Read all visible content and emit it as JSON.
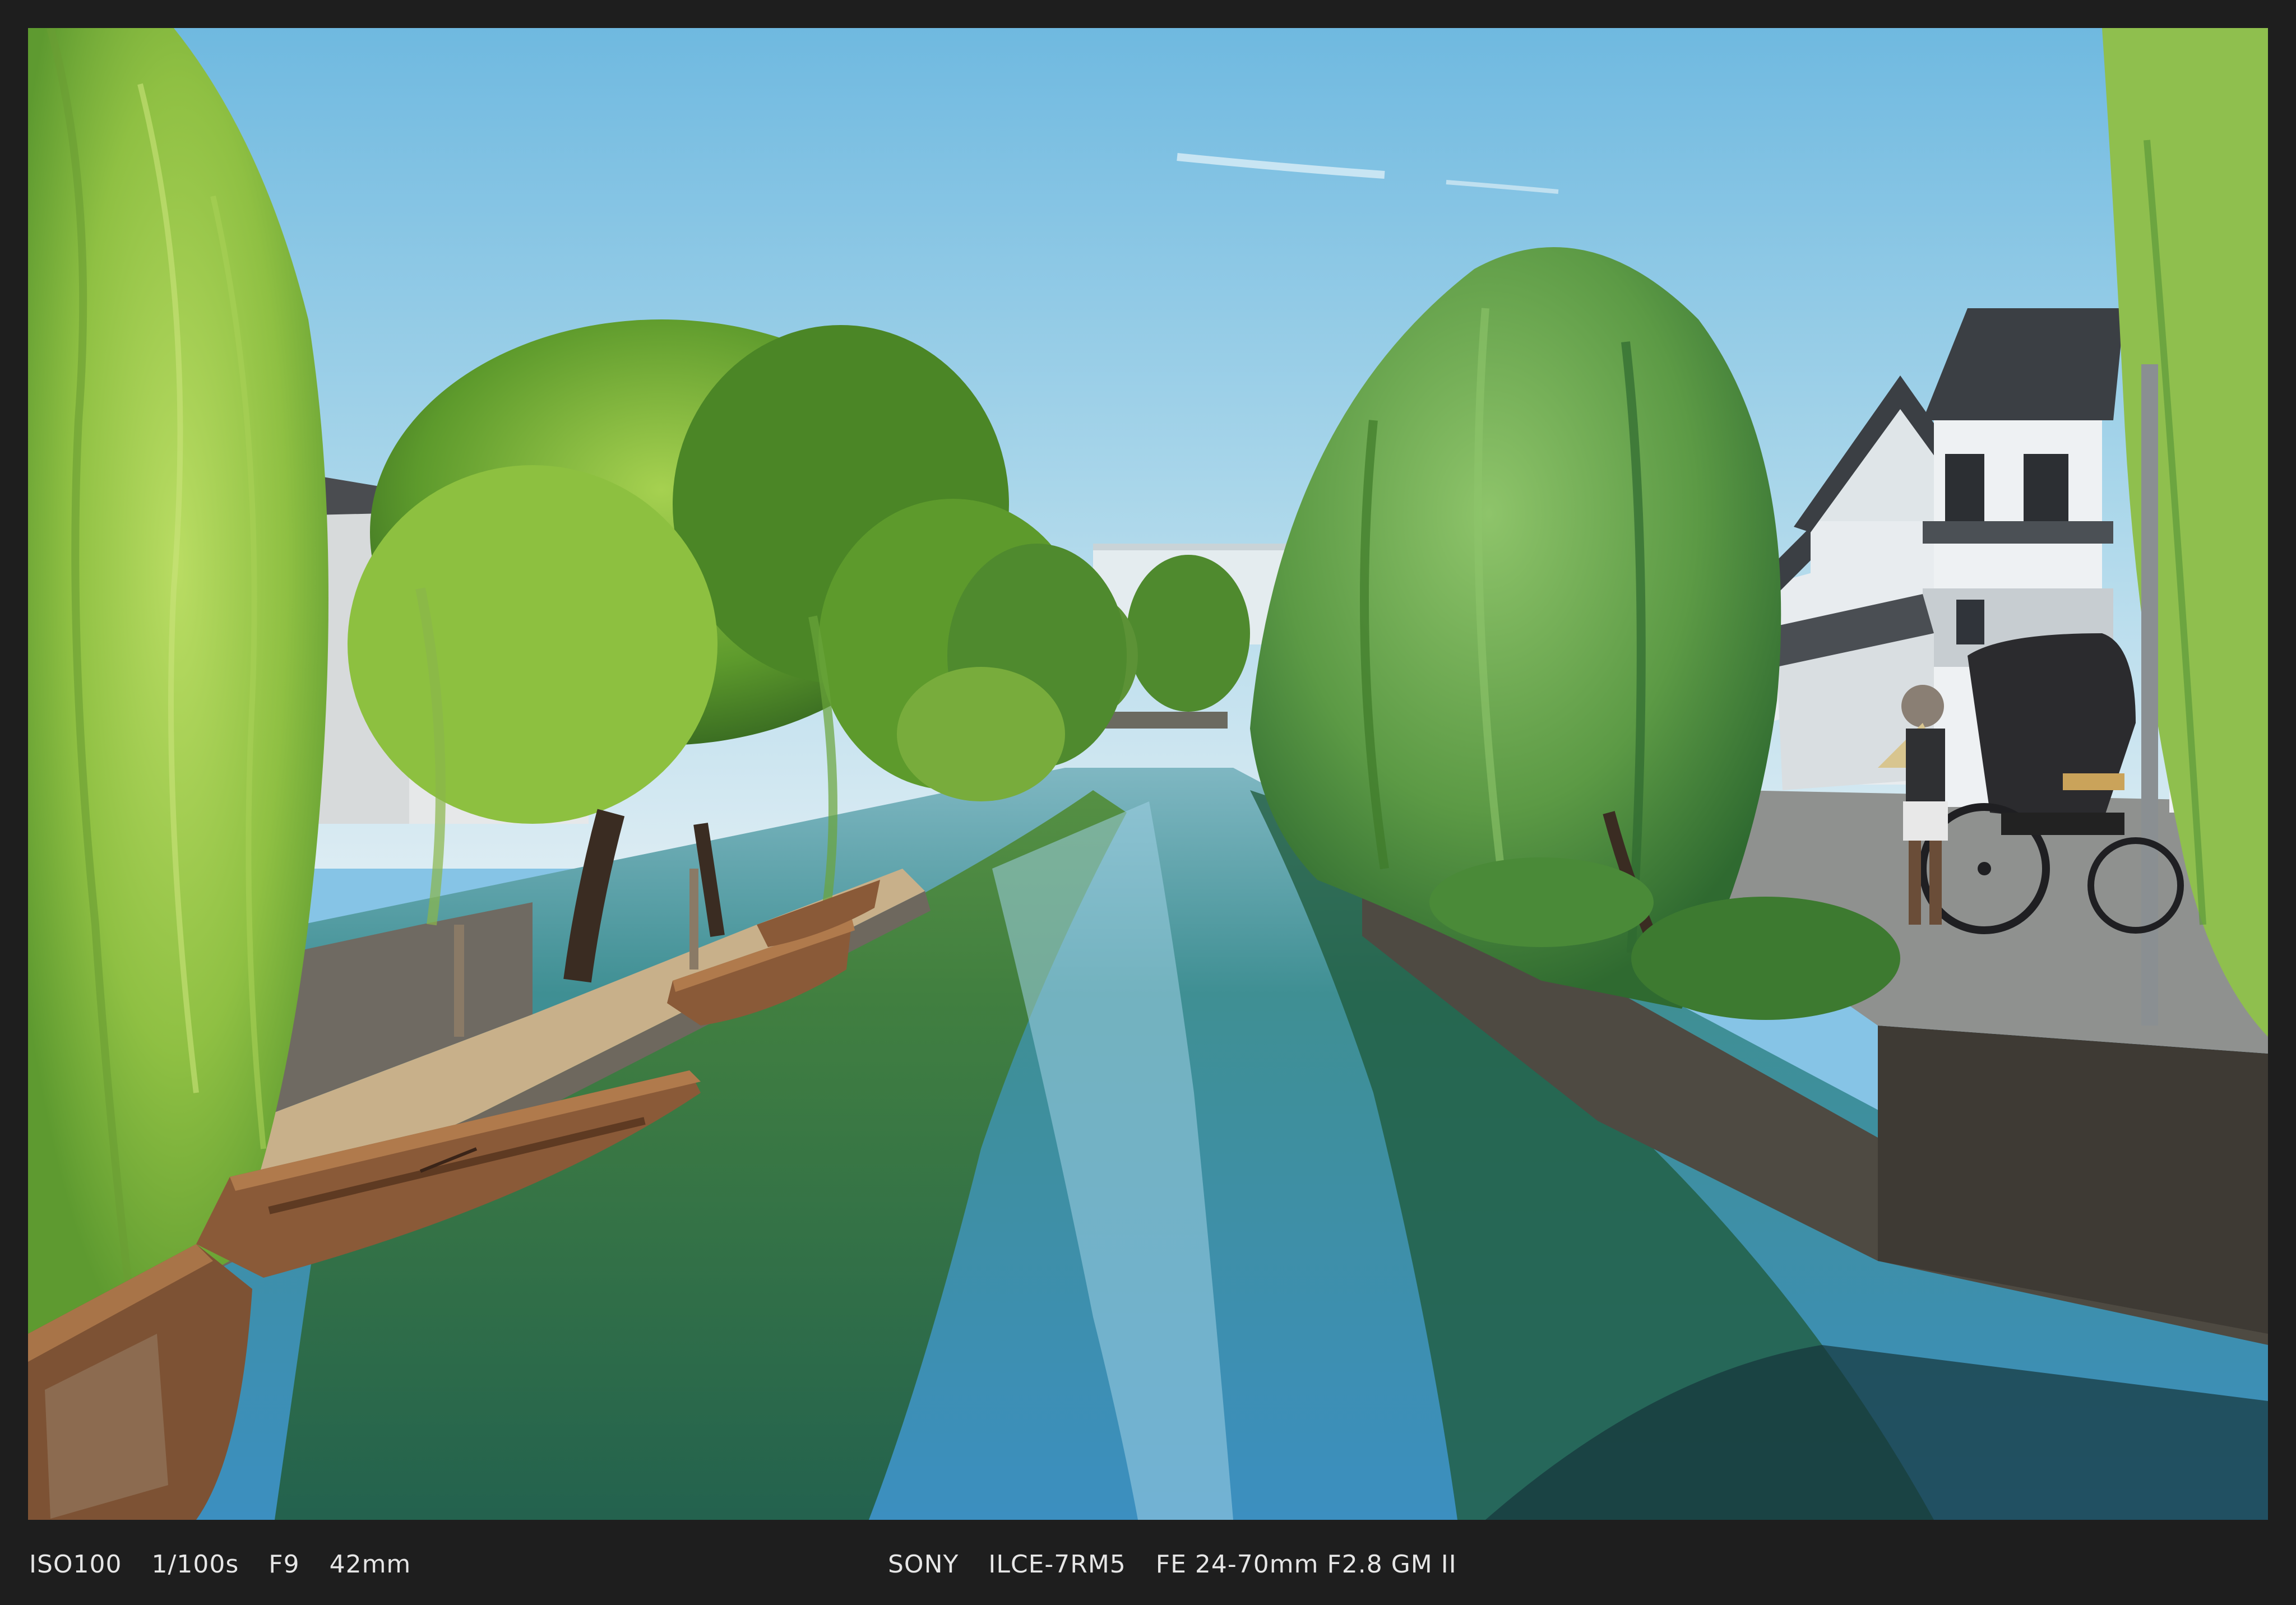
{
  "photo": {
    "scene": "canal-with-willows-boats-and-storehouses",
    "colors": {
      "sky_top": "#6fb9e0",
      "sky_bottom": "#dcecf3",
      "willow_light": "#9cc94a",
      "willow_dark": "#3f7a2a",
      "water": "#2f7f8f",
      "boat": "#8a5a38",
      "wall": "#e8ecef",
      "roof": "#3b3f44",
      "stone": "#5a554d"
    }
  },
  "exif": {
    "iso": "ISO100",
    "shutter": "1/100s",
    "aperture": "F9",
    "focal_length": "42mm",
    "brand": "SONY",
    "model": "ILCE-7RM5",
    "lens": "FE 24-70mm F2.8 GM II"
  }
}
